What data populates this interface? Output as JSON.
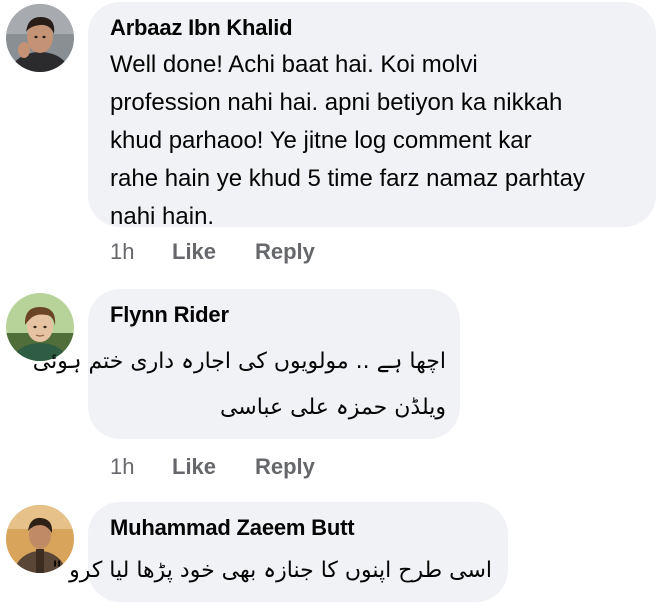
{
  "comments": [
    {
      "author": "Arbaaz Ibn Khalid",
      "avatar_icon": "profile-photo-icon",
      "lines": [
        "Well done! Achi baat hai. Koi molvi",
        "profession nahi hai. apni betiyon ka nikkah",
        "khud parhaoo! Ye jitne log comment kar",
        "rahe hain ye khud 5 time farz namaz parhtay",
        "nahi hain."
      ],
      "time": "1h",
      "like_label": "Like",
      "reply_label": "Reply"
    },
    {
      "author": "Flynn Rider",
      "avatar_icon": "profile-photo-icon",
      "lines": [
        "اچھا ہے .. مولویوں کی اجارہ داری ختم ہوئی",
        "ویلڈن حمزہ علی عباسی"
      ],
      "time": "1h",
      "like_label": "Like",
      "reply_label": "Reply"
    },
    {
      "author": "Muhammad Zaeem Butt",
      "avatar_icon": "profile-photo-icon",
      "lines": [
        "اسی طرح اپنوں کا جنازہ بھی خود پڑھا لیا کرو \""
      ]
    }
  ],
  "colors": {
    "bubble_bg": "#f0f2f5",
    "meta_text": "#65676b",
    "text": "#050505"
  }
}
